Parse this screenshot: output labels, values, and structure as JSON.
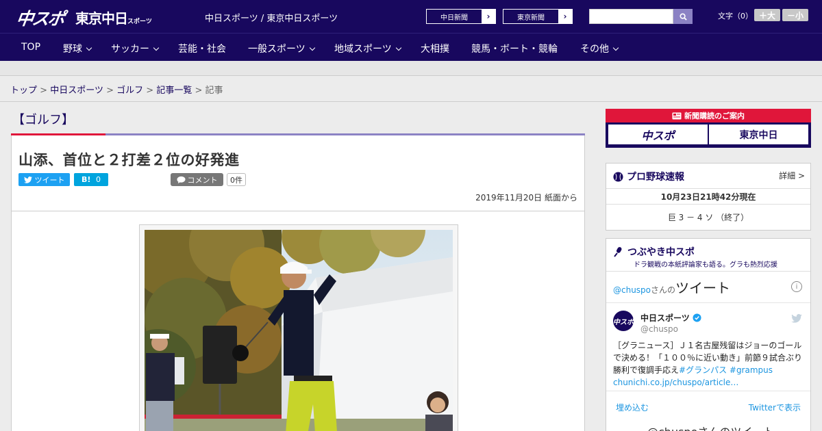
{
  "header": {
    "logo_chuspo": "中スポ",
    "logo_tokyo": "東京中日",
    "logo_tokyo_suffix": "スポーツ",
    "site_name": "中日スポーツ / 東京中日スポーツ",
    "ext_links": [
      "中日新聞",
      "東京新聞"
    ],
    "search_placeholder": "",
    "font_size_label": "文字（0）",
    "font_plus": "＋大",
    "font_minus": "－小"
  },
  "nav": {
    "items": [
      "TOP",
      "野球",
      "サッカー",
      "芸能・社会",
      "一般スポーツ",
      "地域スポーツ",
      "大相撲",
      "競馬・ボート・競輪",
      "その他"
    ]
  },
  "breadcrumb": {
    "items": [
      "トップ",
      "中日スポーツ",
      "ゴルフ",
      "記事一覧"
    ],
    "current": "記事",
    "separator": ">"
  },
  "article": {
    "category": "【ゴルフ】",
    "headline": "山添、首位と２打差２位の好発進",
    "tweet_label": "ツイート",
    "hatena_label": "B!",
    "hatena_count": "0",
    "comment_label": "コメント",
    "comment_count": "0件",
    "date": "2019年11月20日 紙面から"
  },
  "sidebar": {
    "promo_title": "新聞購読のご案内",
    "promo_logos": [
      "中スポ",
      "東京中日"
    ],
    "baseball": {
      "title": "プロ野球速報",
      "detail_link": "詳細 >",
      "time": "10月23日21時42分現在",
      "score": "巨 3 － 4 ソ （終了）"
    },
    "tweets": {
      "title": "つぶやき中スポ",
      "subtitle": "ドラ観戦の本紙評論家も語る。グラも熱烈応援",
      "head_handle": "@chuspo",
      "head_san": "さんの",
      "head_tweet": "ツイート",
      "account_name": "中日スポーツ",
      "account_handle": "@chuspo",
      "avatar_text": "中スポ",
      "text_main": "［グラニュース］Ｊ１名古屋残留はジョーのゴールで決める！「１００％に近い動き」前節９試合ぶり勝利で復調手応え",
      "hashtags": "#グランパス #grampus",
      "link": "chunichi.co.jp/chuspo/article…",
      "embed_link": "埋め込む",
      "show_link": "Twitterで表示",
      "more": "@chuspoさんのツイート"
    }
  },
  "colors": {
    "brand_navy": "#18085e",
    "accent_red": "#e0163a",
    "twitter_blue": "#1da1f2"
  }
}
